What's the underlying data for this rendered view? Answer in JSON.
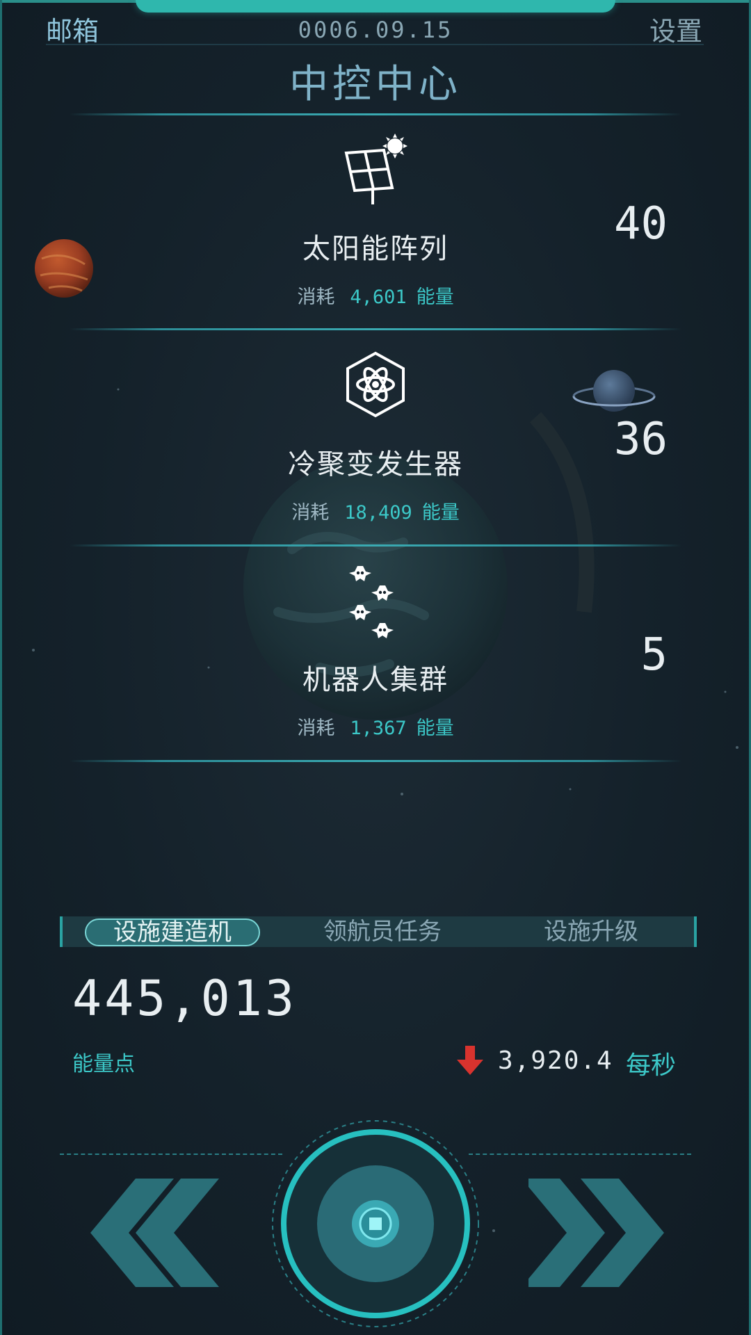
{
  "header": {
    "mail_label": "邮箱",
    "date": "0006.09.15",
    "settings_label": "设置",
    "title": "中控中心"
  },
  "facilities": [
    {
      "name": "太阳能阵列",
      "cost_label": "消耗",
      "cost_value": "4,601",
      "cost_unit": "能量",
      "count": "40",
      "icon": "solar-panel-icon"
    },
    {
      "name": "冷聚变发生器",
      "cost_label": "消耗",
      "cost_value": "18,409",
      "cost_unit": "能量",
      "count": "36",
      "icon": "atom-hexagon-icon"
    },
    {
      "name": "机器人集群",
      "cost_label": "消耗",
      "cost_value": "1,367",
      "cost_unit": "能量",
      "count": "5",
      "icon": "drone-swarm-icon"
    }
  ],
  "tabs": [
    {
      "label": "设施建造机",
      "active": true
    },
    {
      "label": "领航员任务",
      "active": false
    },
    {
      "label": "设施升级",
      "active": false
    }
  ],
  "energy": {
    "total": "445,013",
    "label": "能量点",
    "rate": "3,920.4",
    "rate_unit": "每秒",
    "rate_direction": "down"
  },
  "controls": {
    "left_icon": "double-chevron-left-icon",
    "right_icon": "double-chevron-right-icon",
    "center_icon": "core-button-icon"
  },
  "colors": {
    "accent": "#3cc8c8",
    "frame": "#2fb7ad",
    "rate_down": "#d8332e"
  }
}
